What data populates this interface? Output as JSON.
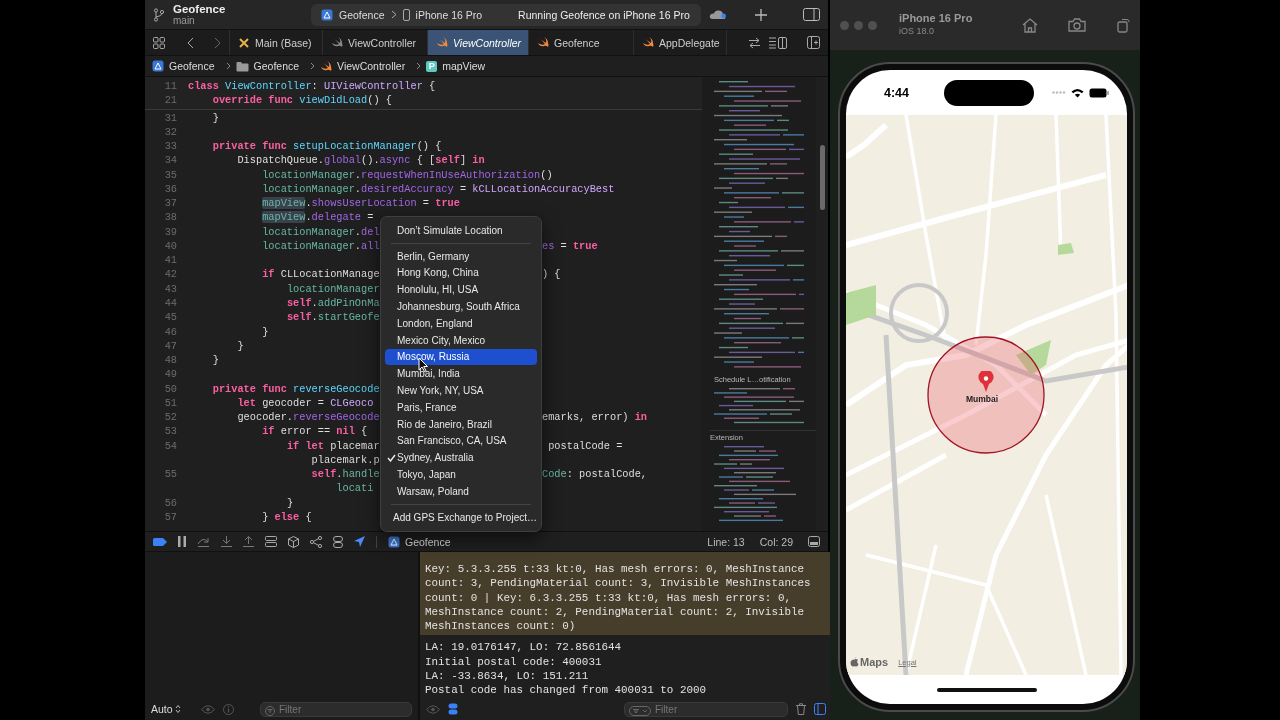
{
  "toolbar": {
    "project": "Geofence",
    "branch": "main",
    "scheme": "Geofence",
    "device": "iPhone 16 Pro",
    "status": "Running Geofence on iPhone 16 Pro"
  },
  "tabs": [
    {
      "label": "Main (Base)",
      "kind": "xib",
      "selected": false
    },
    {
      "label": "ViewController",
      "kind": "swift",
      "selected": false
    },
    {
      "label": "ViewController",
      "kind": "swift",
      "selected": true
    },
    {
      "label": "Geofence",
      "kind": "swift",
      "selected": false
    },
    {
      "label": "AppDelegate",
      "kind": "swift",
      "selected": false
    }
  ],
  "jump_bar": [
    {
      "label": "Geofence",
      "kind": "project"
    },
    {
      "label": "Geofence",
      "kind": "folder"
    },
    {
      "label": "ViewController",
      "kind": "swift"
    },
    {
      "label": "mapView",
      "kind": "property",
      "badge": "P"
    }
  ],
  "editor": {
    "sticky_lines": [
      {
        "number": "11",
        "left": [
          {
            "kind": "kw",
            "text": "class "
          },
          {
            "kind": "decl",
            "text": "ViewController"
          },
          {
            "kind": "plain",
            "text": ": "
          },
          {
            "kind": "systype",
            "text": "UIViewController"
          },
          {
            "kind": "plain",
            "text": " {"
          }
        ]
      },
      {
        "number": "21",
        "left": [
          {
            "kind": "kw",
            "text": "    override func "
          },
          {
            "kind": "decl",
            "text": "viewDidLoad"
          },
          {
            "kind": "plain",
            "text": "() {"
          }
        ]
      }
    ],
    "lines": [
      {
        "number": "31",
        "left": [
          {
            "kind": "plain",
            "text": "    }"
          }
        ]
      },
      {
        "number": "32"
      },
      {
        "number": "33",
        "left": [
          {
            "kind": "kw",
            "text": "    private func "
          },
          {
            "kind": "decl",
            "text": "setupLocationManager"
          },
          {
            "kind": "plain",
            "text": "() {"
          }
        ]
      },
      {
        "number": "34",
        "left": [
          {
            "kind": "plain",
            "text": "        DispatchQueue."
          },
          {
            "kind": "sys",
            "text": "global"
          },
          {
            "kind": "plain",
            "text": "()."
          },
          {
            "kind": "sys",
            "text": "async"
          },
          {
            "kind": "plain",
            "text": " { ["
          },
          {
            "kind": "kw",
            "text": "self"
          },
          {
            "kind": "plain",
            "text": "] "
          },
          {
            "kind": "kw",
            "text": "in"
          }
        ]
      },
      {
        "number": "35",
        "left": [
          {
            "kind": "fn",
            "text": "            locationManager"
          },
          {
            "kind": "plain",
            "text": "."
          },
          {
            "kind": "sys",
            "text": "requestWhenInUseAuthorization"
          },
          {
            "kind": "plain",
            "text": "()"
          }
        ]
      },
      {
        "number": "36",
        "left": [
          {
            "kind": "fn",
            "text": "            locationManager"
          },
          {
            "kind": "plain",
            "text": "."
          },
          {
            "kind": "sys",
            "text": "desiredAccuracy"
          },
          {
            "kind": "plain",
            "text": " = "
          },
          {
            "kind": "systype",
            "text": "kCLLocationAccuracyBest"
          }
        ]
      },
      {
        "number": "37",
        "left": [
          {
            "kind": "hl",
            "text": "            mapView"
          },
          {
            "kind": "plain",
            "text": "."
          },
          {
            "kind": "sys",
            "text": "showsUserLocation"
          },
          {
            "kind": "plain",
            "text": " = "
          },
          {
            "kind": "kw",
            "text": "true"
          }
        ]
      },
      {
        "number": "38",
        "left": [
          {
            "kind": "hl",
            "text": "            mapView"
          },
          {
            "kind": "plain",
            "text": "."
          },
          {
            "kind": "sys",
            "text": "delegate"
          },
          {
            "kind": "plain",
            "text": " ="
          }
        ]
      },
      {
        "number": "39",
        "left": [
          {
            "kind": "fn",
            "text": "            locationManager"
          },
          {
            "kind": "plain",
            "text": "."
          },
          {
            "kind": "sys",
            "text": "del"
          }
        ]
      },
      {
        "number": "40",
        "left": [
          {
            "kind": "fn",
            "text": "            locationManager"
          },
          {
            "kind": "plain",
            "text": "."
          },
          {
            "kind": "sys",
            "text": "all"
          }
        ],
        "right": [
          {
            "kind": "sys",
            "text": "es"
          },
          {
            "kind": "plain",
            "text": " = "
          },
          {
            "kind": "kw",
            "text": "true"
          }
        ]
      },
      {
        "number": "41"
      },
      {
        "number": "42",
        "left": [
          {
            "kind": "kw",
            "text": "            if "
          },
          {
            "kind": "plain",
            "text": "CLLocationManage"
          }
        ],
        "right": [
          {
            "kind": "plain",
            "text": ") {"
          }
        ]
      },
      {
        "number": "43",
        "left": [
          {
            "kind": "fn",
            "text": "                locationManager"
          }
        ]
      },
      {
        "number": "44",
        "left": [
          {
            "kind": "kw",
            "text": "                self"
          },
          {
            "kind": "plain",
            "text": "."
          },
          {
            "kind": "fn",
            "text": "addPinOnMa"
          }
        ]
      },
      {
        "number": "45",
        "left": [
          {
            "kind": "kw",
            "text": "                self"
          },
          {
            "kind": "plain",
            "text": "."
          },
          {
            "kind": "fn",
            "text": "startGeofe"
          }
        ]
      },
      {
        "number": "46",
        "left": [
          {
            "kind": "plain",
            "text": "            }"
          }
        ]
      },
      {
        "number": "47",
        "left": [
          {
            "kind": "plain",
            "text": "        }"
          }
        ]
      },
      {
        "number": "48",
        "left": [
          {
            "kind": "plain",
            "text": "    }"
          }
        ]
      },
      {
        "number": "49"
      },
      {
        "number": "50",
        "left": [
          {
            "kind": "kw",
            "text": "    private func "
          },
          {
            "kind": "decl",
            "text": "reverseGeocode"
          }
        ]
      },
      {
        "number": "51",
        "left": [
          {
            "kind": "kw",
            "text": "        let "
          },
          {
            "kind": "plain",
            "text": "geocoder = "
          },
          {
            "kind": "systype",
            "text": "CLGeoco"
          }
        ]
      },
      {
        "number": "52",
        "left": [
          {
            "kind": "plain",
            "text": "        geocoder."
          },
          {
            "kind": "sys",
            "text": "reverseGeocode"
          }
        ],
        "right": [
          {
            "kind": "plain",
            "text": "emarks, error) "
          },
          {
            "kind": "kw",
            "text": "in"
          }
        ]
      },
      {
        "number": "53",
        "left": [
          {
            "kind": "kw",
            "text": "            if "
          },
          {
            "kind": "plain",
            "text": "error == "
          },
          {
            "kind": "kw",
            "text": "nil"
          },
          {
            "kind": "plain",
            "text": " {"
          }
        ]
      },
      {
        "number": "54",
        "left": [
          {
            "kind": "kw",
            "text": "                if let "
          },
          {
            "kind": "plain",
            "text": "placemar"
          }
        ],
        "right": [
          {
            "kind": "plain",
            "text": " postalCode ="
          }
        ]
      },
      {
        "left": [
          {
            "kind": "plain",
            "text": "                    placemark.p"
          }
        ]
      },
      {
        "number": "55",
        "left": [
          {
            "kind": "kw",
            "text": "                    self"
          },
          {
            "kind": "plain",
            "text": "."
          },
          {
            "kind": "fn",
            "text": "handle"
          }
        ],
        "right": [
          {
            "kind": "fn",
            "text": "Code"
          },
          {
            "kind": "plain",
            "text": ": postalCode,"
          }
        ]
      },
      {
        "left": [
          {
            "kind": "fn",
            "text": "                        locati"
          }
        ]
      },
      {
        "number": "56",
        "left": [
          {
            "kind": "plain",
            "text": "                }"
          }
        ]
      },
      {
        "number": "57",
        "left": [
          {
            "kind": "plain",
            "text": "            } "
          },
          {
            "kind": "kw",
            "text": "else"
          },
          {
            "kind": "plain",
            "text": " {"
          }
        ]
      }
    ]
  },
  "minimap": {
    "labels": [
      "Schedule L…otification",
      "Extension"
    ]
  },
  "location_menu": {
    "sections": [
      [
        {
          "label": "Don’t Simulate Location",
          "selected": false,
          "checked": false
        }
      ],
      [
        {
          "label": "Berlin, Germany",
          "selected": false,
          "checked": false
        },
        {
          "label": "Hong Kong, China",
          "selected": false,
          "checked": false
        },
        {
          "label": "Honolulu, HI, USA",
          "selected": false,
          "checked": false
        },
        {
          "label": "Johannesburg, South Africa",
          "selected": false,
          "checked": false
        },
        {
          "label": "London, England",
          "selected": false,
          "checked": false
        },
        {
          "label": "Mexico City, Mexico",
          "selected": false,
          "checked": false
        },
        {
          "label": "Moscow, Russia",
          "selected": true,
          "checked": false
        },
        {
          "label": "Mumbai, India",
          "selected": false,
          "checked": false
        },
        {
          "label": "New York, NY, USA",
          "selected": false,
          "checked": false
        },
        {
          "label": "Paris, France",
          "selected": false,
          "checked": false
        },
        {
          "label": "Rio de Janeiro, Brazil",
          "selected": false,
          "checked": false
        },
        {
          "label": "San Francisco, CA, USA",
          "selected": false,
          "checked": false
        },
        {
          "label": "Sydney, Australia",
          "selected": false,
          "checked": true
        },
        {
          "label": "Tokyo, Japan",
          "selected": false,
          "checked": false
        },
        {
          "label": "Warsaw, Poland",
          "selected": false,
          "checked": false
        }
      ],
      [
        {
          "label": "Add GPS Exchange to Project…",
          "selected": false,
          "checked": false
        }
      ]
    ]
  },
  "debug_bar": {
    "target": "Geofence",
    "line": "Line: 13",
    "column": "Col: 29"
  },
  "variables": {
    "scope": "Auto",
    "filter": {
      "placeholder": "Filter"
    }
  },
  "console": {
    "highlighted_lines": [
      "Key: 5.3.3.255 t:33 kt:0, Has mesh errors: 0, MeshInstance",
      "count: 3, PendingMaterial count: 3, Invisible MeshInstances",
      "count: 0 | Key: 6.3.3.255 t:33 kt:0, Has mesh errors: 0,",
      "MeshInstance count: 2, PendingMaterial count: 2, Invisible",
      "MeshInstances count: 0)"
    ],
    "lines": [
      "LA: 19.0176147, LO: 72.8561644",
      "Initial postal code: 400031",
      "LA: -33.8634, LO: 151.211",
      "Postal code has changed from 400031 to 2000"
    ],
    "filter": {
      "placeholder": "Filter"
    }
  },
  "simulator": {
    "device": "iPhone 16 Pro",
    "os": "iOS 18.0",
    "time": "4:44",
    "pin_label": "Mumbai",
    "maps_logo": "Maps",
    "legal": "Legal"
  }
}
